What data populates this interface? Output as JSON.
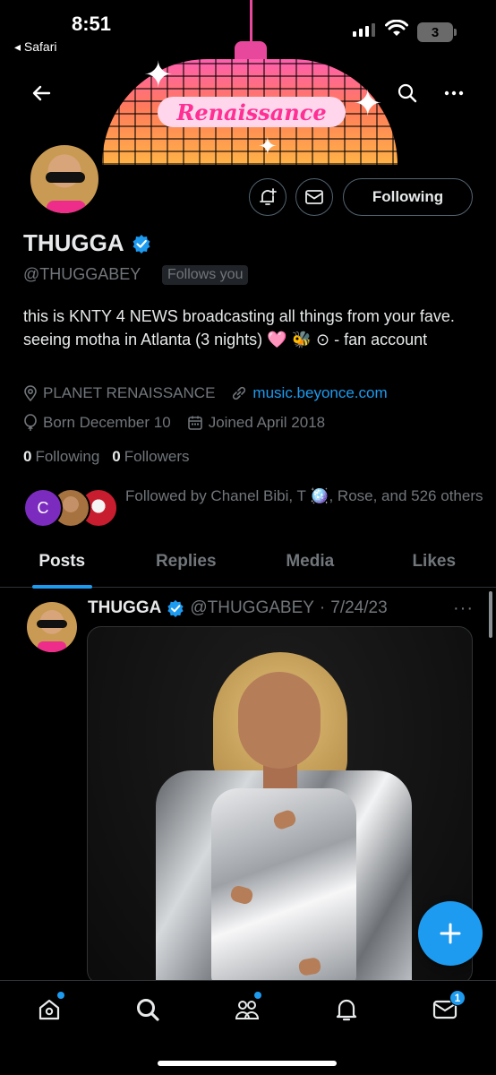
{
  "status_bar": {
    "time": "8:51",
    "back_app": "◂ Safari",
    "battery": "3"
  },
  "banner": {
    "title": "Renaissance"
  },
  "profile": {
    "display_name": "THUGGA",
    "handle": "@THUGGABEY",
    "follows_you": "Follows you",
    "bio": "this is KNTY 4 NEWS broadcasting all things from your fave. seeing motha in Atlanta (3 nights) 🩷 🐝 ⊙ - fan account",
    "location": "PLANET RENAISSANCE",
    "website": "music.beyonce.com",
    "birthday": "Born December 10",
    "joined": "Joined April 2018",
    "following_count": "0",
    "following_label": "Following",
    "followers_count": "0",
    "followers_label": "Followers",
    "followed_by_avatar_initial": "C",
    "followed_by": "Followed by Chanel Bibi, T 🪩, Rose, and 526 others",
    "following_button": "Following"
  },
  "tabs": [
    "Posts",
    "Replies",
    "Media",
    "Likes"
  ],
  "active_tab": "Posts",
  "post": {
    "name": "THUGGA",
    "handle": "@THUGGABEY",
    "separator": "·",
    "date": "7/24/23",
    "more": "···"
  },
  "bottom_nav": {
    "items": [
      "home-icon",
      "search-icon",
      "communities-icon",
      "notifications-icon",
      "messages-icon"
    ],
    "messages_badge": "1"
  },
  "colors": {
    "accent": "#1d9bf0",
    "muted": "#71767b",
    "text": "#e7e9ea",
    "background": "#000000"
  }
}
